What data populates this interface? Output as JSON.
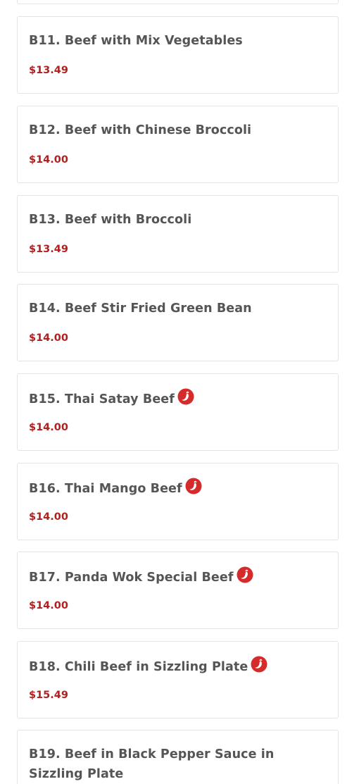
{
  "menu": {
    "items": [
      {
        "name": "",
        "price": ""
      },
      {
        "name": "B11. Beef with Mix Vegetables",
        "price": "$13.49",
        "spicy": false
      },
      {
        "name": "B12. Beef with Chinese Broccoli",
        "price": "$14.00",
        "spicy": false
      },
      {
        "name": "B13. Beef with Broccoli",
        "price": "$13.49",
        "spicy": false
      },
      {
        "name": "B14. Beef Stir Fried Green Bean",
        "price": "$14.00",
        "spicy": false
      },
      {
        "name": "B15. Thai Satay Beef",
        "price": "$14.00",
        "spicy": true
      },
      {
        "name": "B16. Thai Mango Beef",
        "price": "$14.00",
        "spicy": true
      },
      {
        "name": "B17. Panda Wok Special Beef",
        "price": "$14.00",
        "spicy": true
      },
      {
        "name": "B18. Chili Beef in Sizzling Plate",
        "price": "$15.49",
        "spicy": true
      },
      {
        "name": "B19. Beef in Black Pepper Sauce in Sizzling Plate",
        "price": "",
        "spicy": false
      }
    ]
  },
  "colors": {
    "item_name": "#555555",
    "price": "#b21f1f",
    "spicy_icon": "#d52b2b",
    "card_border": "#e4e4e4"
  },
  "icons": {
    "spicy": "chili-pepper-icon"
  }
}
